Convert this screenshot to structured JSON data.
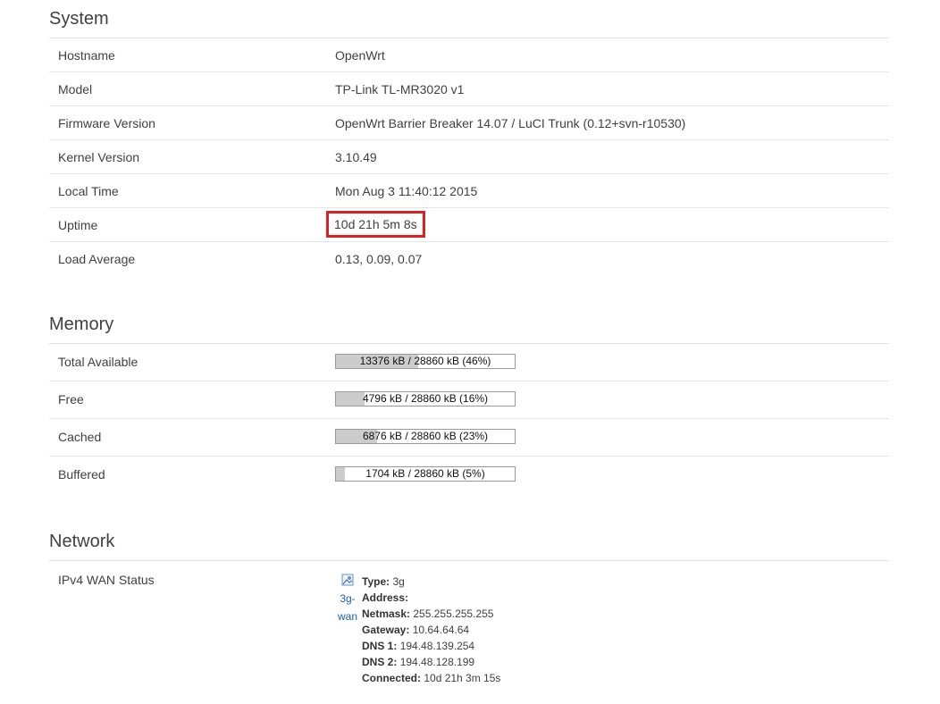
{
  "system": {
    "title": "System",
    "rows": [
      {
        "label": "Hostname",
        "value": "OpenWrt"
      },
      {
        "label": "Model",
        "value": "TP-Link TL-MR3020 v1"
      },
      {
        "label": "Firmware Version",
        "value": "OpenWrt Barrier Breaker 14.07 / LuCI Trunk (0.12+svn-r10530)"
      },
      {
        "label": "Kernel Version",
        "value": "3.10.49"
      },
      {
        "label": "Local Time",
        "value": "Mon Aug 3 11:40:12 2015"
      },
      {
        "label": "Uptime",
        "value": "10d 21h 5m 8s"
      },
      {
        "label": "Load Average",
        "value": "0.13, 0.09, 0.07"
      }
    ],
    "highlight_color": "#e02020"
  },
  "memory": {
    "title": "Memory",
    "rows": [
      {
        "label": "Total Available",
        "text": "13376 kB / 28860 kB (46%)",
        "fraction": 0.46
      },
      {
        "label": "Free",
        "text": "4796 kB / 28860 kB (16%)",
        "fraction": 0.16
      },
      {
        "label": "Cached",
        "text": "6876 kB / 28860 kB (23%)",
        "fraction": 0.23
      },
      {
        "label": "Buffered",
        "text": "1704 kB / 28860 kB (5%)",
        "fraction": 0.05
      }
    ]
  },
  "network": {
    "title": "Network",
    "ipv4_label": "IPv4 WAN Status",
    "iface_icon": "network-interface-icon",
    "iface_name_1": "3g-",
    "iface_name_2": "wan",
    "details": [
      {
        "key": "Type:",
        "value": "3g"
      },
      {
        "key": "Address:",
        "value": ""
      },
      {
        "key": "Netmask:",
        "value": "255.255.255.255"
      },
      {
        "key": "Gateway:",
        "value": "10.64.64.64"
      },
      {
        "key": "DNS 1:",
        "value": "194.48.139.254"
      },
      {
        "key": "DNS 2:",
        "value": "194.48.128.199"
      },
      {
        "key": "Connected:",
        "value": "10d 21h 3m 15s"
      }
    ]
  }
}
